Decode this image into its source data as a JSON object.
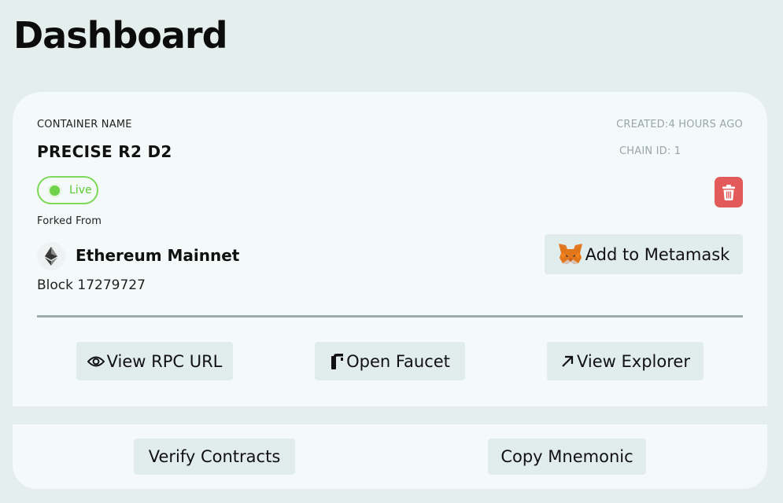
{
  "page": {
    "title": "Dashboard"
  },
  "container": {
    "label": "CONTAINER NAME",
    "name": "PRECISE R2 D2",
    "created": "CREATED:4 HOURS AGO",
    "chain_id": "CHAIN ID: 1",
    "status": "Live",
    "forked_label": "Forked From",
    "network": "Ethereum Mainnet",
    "block": "Block 17279727"
  },
  "actions": {
    "add_metamask": "Add to Metamask",
    "view_rpc": "View RPC URL",
    "open_faucet": "Open Faucet",
    "view_explorer": "View Explorer",
    "verify_contracts": "Verify Contracts",
    "copy_mnemonic": "Copy Mnemonic"
  },
  "icons": {
    "delete": "trash-icon",
    "network": "ethereum-icon",
    "metamask": "metamask-fox-icon",
    "rpc": "eye-icon",
    "faucet": "faucet-icon",
    "explorer": "arrow-up-right-icon"
  },
  "colors": {
    "background": "#e3eeed",
    "card": "#f4f9f9",
    "live": "#7ed957",
    "danger": "#e25a5a",
    "button": "#e1ecec"
  }
}
